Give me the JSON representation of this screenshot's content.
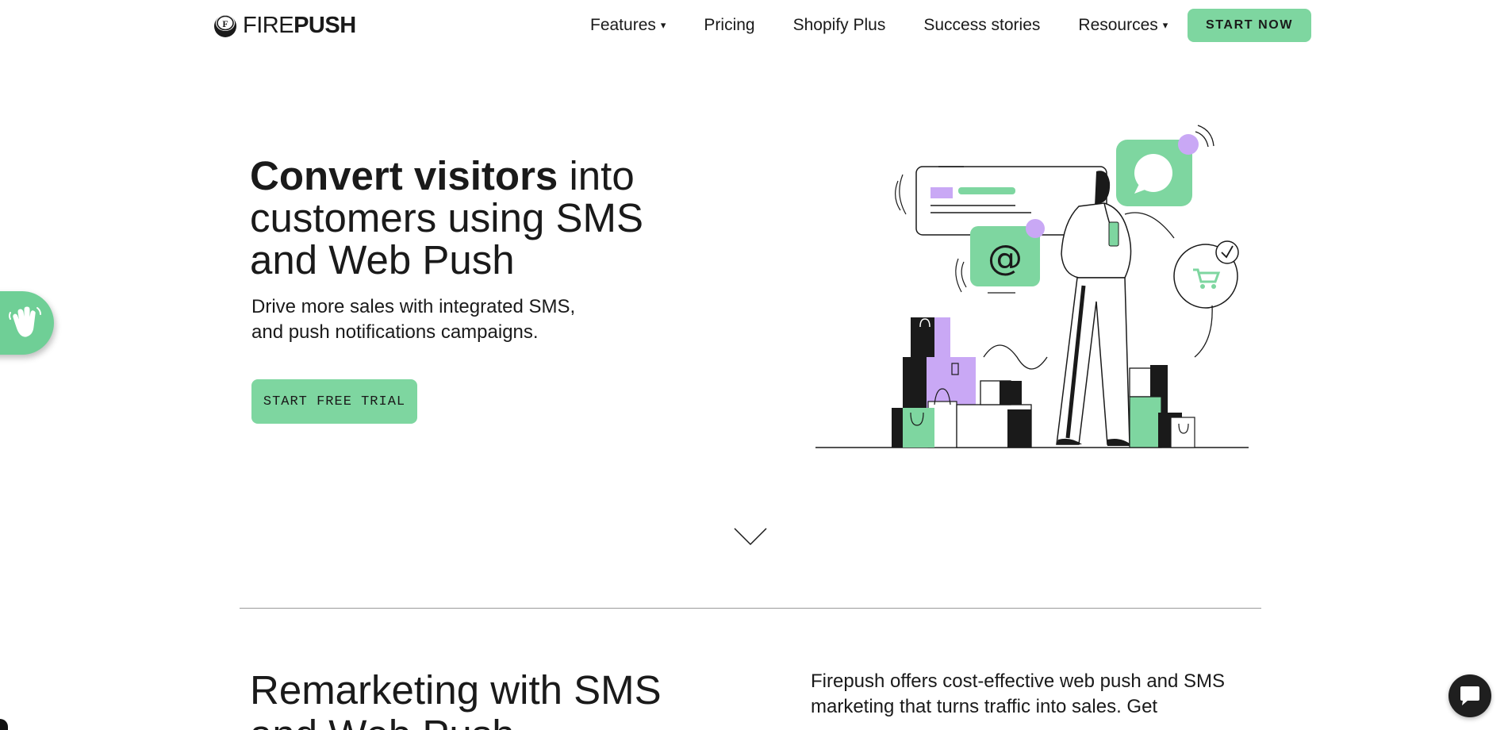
{
  "header": {
    "logo": {
      "icon": "firepush-logo-icon",
      "part1": "FIRE",
      "part2": "PUSH"
    },
    "nav": [
      {
        "label": "Features",
        "dropdown": true
      },
      {
        "label": "Pricing",
        "dropdown": false
      },
      {
        "label": "Shopify Plus",
        "dropdown": false
      },
      {
        "label": "Success stories",
        "dropdown": false
      },
      {
        "label": "Resources",
        "dropdown": true
      }
    ],
    "caret": "▾",
    "cta_label": "START NOW"
  },
  "hero": {
    "title_bold": "Convert visitors",
    "title_rest": " into customers using SMS and Web Push",
    "subtitle": "Drive more sales with integrated SMS, and push notifications campaigns.",
    "cta_label": "START FREE TRIAL"
  },
  "remarketing": {
    "title": "Remarketing with SMS and Web Push",
    "text": "Firepush offers cost-effective web push and SMS marketing that turns traffic into sales. Get"
  },
  "icons": {
    "wave": "waving-hand-icon",
    "scroll": "chevron-down-icon",
    "chat": "chat-icon"
  },
  "colors": {
    "accent": "#7ed6a0",
    "purple": "#c9a8f5",
    "dark": "#1a1a1a"
  }
}
